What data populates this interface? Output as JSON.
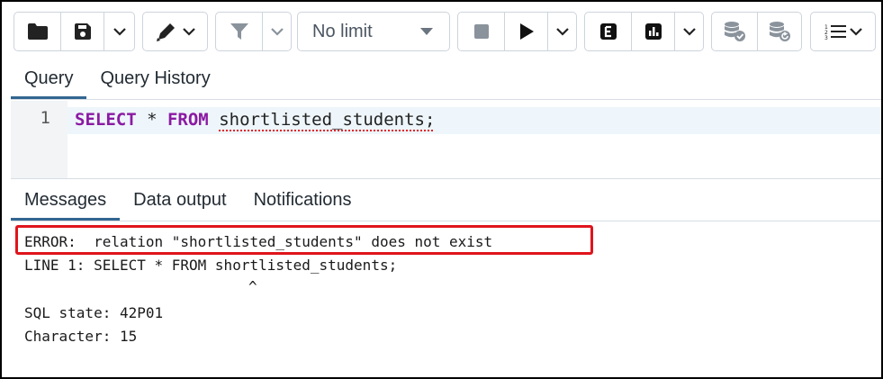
{
  "toolbar": {
    "limit_label": "No limit",
    "icons": {
      "open": "folder-icon",
      "save": "save-icon",
      "save_more": "chevron-down-icon",
      "edit": "pen-icon",
      "edit_more": "chevron-down-icon",
      "filter": "filter-icon",
      "filter_more": "chevron-down-icon",
      "limit_dropdown": "caret-down-icon",
      "stop": "stop-icon",
      "execute": "play-icon",
      "execute_more": "chevron-down-icon",
      "explain": "explain-icon",
      "explain_analyze": "chart-icon",
      "explain_more": "chevron-down-icon",
      "commit": "database-commit-icon",
      "rollback": "database-rollback-icon",
      "macros": "list-icon",
      "macros_more": "chevron-down-icon"
    }
  },
  "editor_tabs": [
    {
      "label": "Query",
      "active": true
    },
    {
      "label": "Query History",
      "active": false
    }
  ],
  "editor": {
    "line_number": "1",
    "tokens": {
      "kw1": "SELECT",
      "op": " * ",
      "kw2": "FROM",
      "space": " ",
      "table": "shortlisted_students",
      "end": ";"
    }
  },
  "output_tabs": [
    {
      "label": "Messages",
      "active": true
    },
    {
      "label": "Data output",
      "active": false
    },
    {
      "label": "Notifications",
      "active": false
    }
  ],
  "messages": {
    "error_line": "ERROR:  relation \"shortlisted_students\" does not exist",
    "line1": "LINE 1: SELECT * FROM shortlisted_students;",
    "caret": "^",
    "sql_state": "SQL state: 42P01",
    "character": "Character: 15"
  },
  "colors": {
    "accent": "#326690",
    "keyword": "#8b1aa3",
    "error_highlight": "#e0141c",
    "current_line": "#eef6fb"
  }
}
